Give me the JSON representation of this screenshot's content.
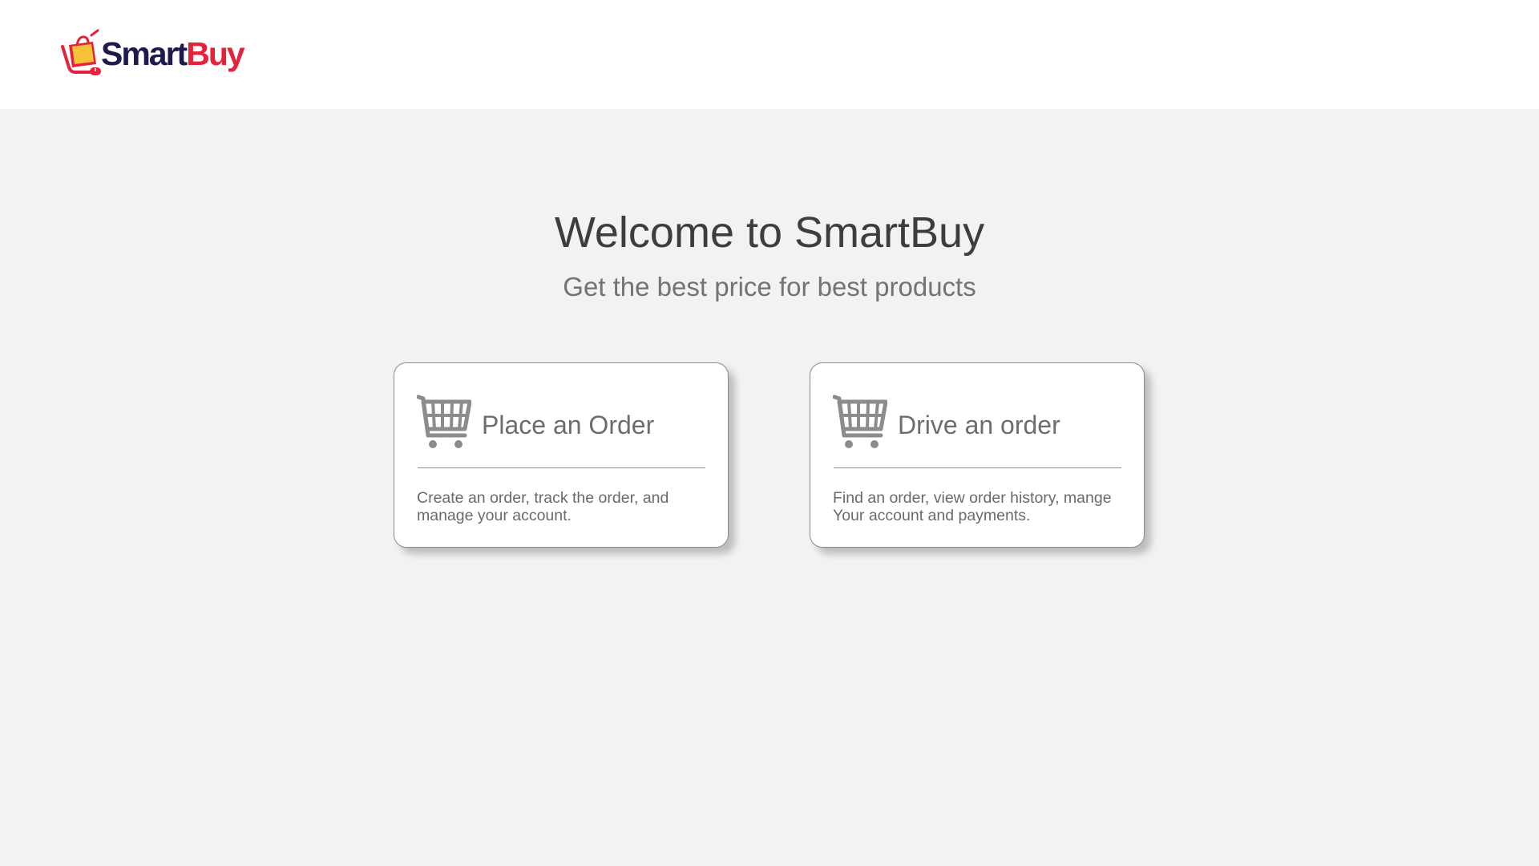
{
  "header": {
    "logo": {
      "text_part1": "Smart",
      "text_part2": "Buy",
      "icon": "shopping-cart-bag-logo",
      "colors": {
        "primary": "#1f1a4e",
        "accent": "#e8213a",
        "bag": "#f7c23a"
      }
    }
  },
  "main": {
    "title": "Welcome to SmartBuy",
    "subtitle": "Get the best price for best products"
  },
  "cards": [
    {
      "icon": "shopping-cart-icon",
      "title": "Place an Order",
      "description": "Create an order, track the order, and manage your account."
    },
    {
      "icon": "shopping-cart-icon",
      "title": "Drive an order",
      "description": "Find an order, view order history, mange Your account and payments."
    }
  ],
  "colors": {
    "page_background": "#f2f2f2",
    "header_background": "#ffffff",
    "card_border": "#8a8a8a",
    "icon_gray": "#8c8c8c"
  }
}
